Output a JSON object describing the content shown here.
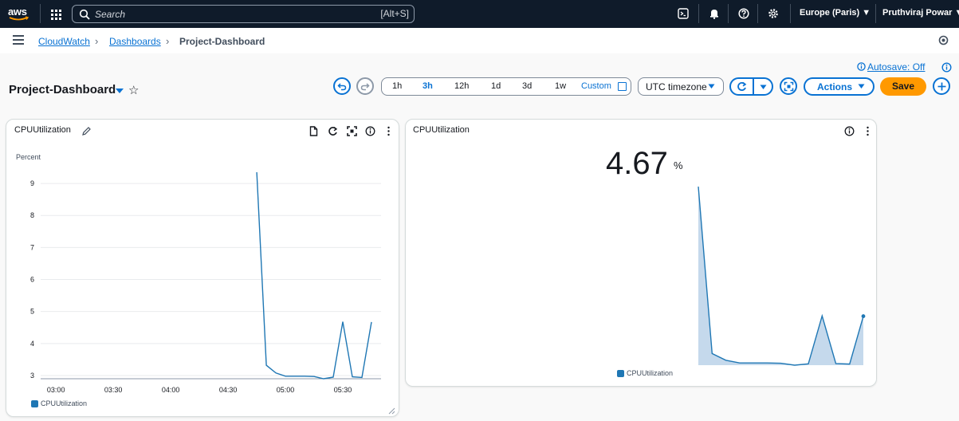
{
  "topnav": {
    "logo": "aws",
    "search_placeholder": "Search",
    "search_shortcut": "[Alt+S]",
    "region": "Europe (Paris) ▼",
    "user": "Pruthviraj Powar ▼",
    "icons": [
      "cloudshell-icon",
      "bell-icon",
      "help-icon",
      "settings-icon"
    ]
  },
  "breadcrumb": {
    "items": [
      "CloudWatch",
      "Dashboards",
      "Project-Dashboard"
    ]
  },
  "header": {
    "autosave": "Autosave: Off",
    "title": "Project-Dashboard",
    "time_ranges": [
      "1h",
      "3h",
      "12h",
      "1d",
      "3d",
      "1w"
    ],
    "selected_range": "3h",
    "custom_label": "Custom",
    "timezone": "UTC timezone",
    "actions_label": "Actions",
    "save_label": "Save"
  },
  "colors": {
    "accent": "#0972d3",
    "series": "#1f77b4",
    "save": "#ff9900",
    "nav": "#0f1b2a"
  },
  "widget1": {
    "title": "CPUUtilization",
    "ylabel": "Percent",
    "legend": "CPUUtilization"
  },
  "widget2": {
    "title": "CPUUtilization",
    "value": "4.67",
    "unit": "%",
    "legend": "CPUUtilization"
  },
  "chart_data": [
    {
      "type": "line",
      "title": "CPUUtilization",
      "ylabel": "Percent",
      "xlabel": "",
      "x_ticks": [
        "03:00",
        "03:30",
        "04:00",
        "04:30",
        "05:00",
        "05:30"
      ],
      "y_ticks": [
        3,
        4,
        5,
        6,
        7,
        8,
        9
      ],
      "ylim": [
        2.9,
        9.5
      ],
      "series": [
        {
          "name": "CPUUtilization",
          "x": [
            "04:45",
            "04:50",
            "04:55",
            "05:00",
            "05:05",
            "05:10",
            "05:15",
            "05:20",
            "05:25",
            "05:30",
            "05:35",
            "05:40",
            "05:45"
          ],
          "values": [
            9.35,
            3.32,
            3.08,
            2.98,
            2.98,
            2.98,
            2.97,
            2.9,
            2.95,
            4.68,
            2.96,
            2.94,
            4.67
          ]
        }
      ],
      "grid": true,
      "legend": "bottom-left"
    },
    {
      "type": "area",
      "title": "CPUUtilization",
      "series": [
        {
          "name": "CPUUtilization",
          "values": [
            9.35,
            3.32,
            3.08,
            2.98,
            2.98,
            2.98,
            2.97,
            2.9,
            2.95,
            4.68,
            2.96,
            2.94,
            4.67
          ]
        }
      ],
      "latest_value": 4.67,
      "legend": "bottom-center"
    }
  ]
}
